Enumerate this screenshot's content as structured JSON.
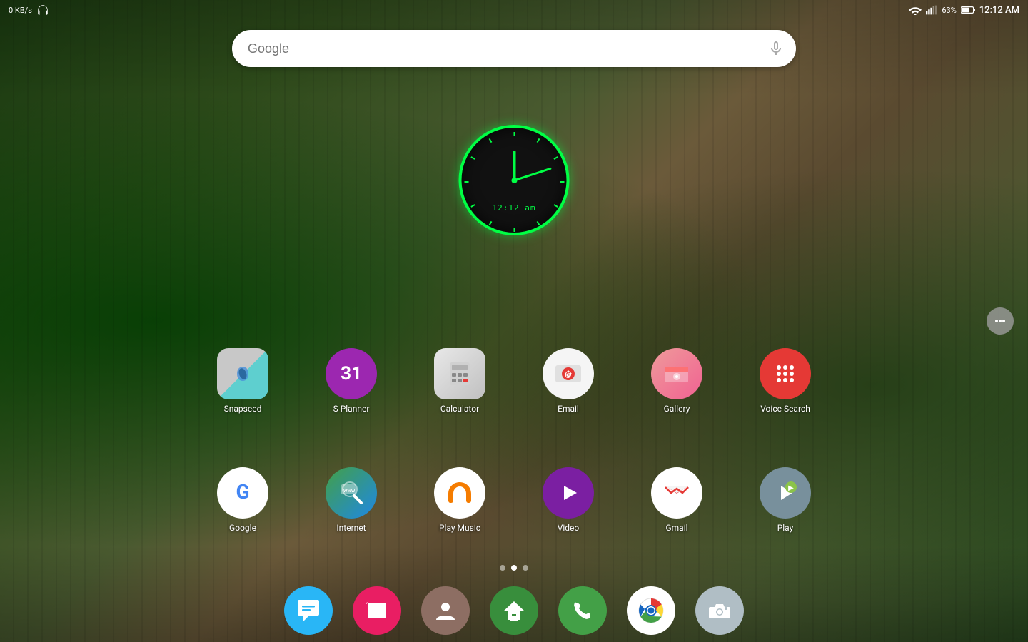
{
  "statusBar": {
    "leftIcons": "0 KB/s",
    "headphonesIcon": "headphones",
    "wifiIcon": "wifi",
    "signalIcon": "signal",
    "batteryPercent": "63%",
    "batteryIcon": "battery",
    "time": "12:12 AM"
  },
  "searchBar": {
    "placeholder": "Google",
    "micIcon": "microphone"
  },
  "clock": {
    "digital": "12:12 am"
  },
  "pageDots": [
    {
      "active": false
    },
    {
      "active": false
    },
    {
      "active": true
    }
  ],
  "appsRow1": [
    {
      "name": "snapseed",
      "label": "Snapseed"
    },
    {
      "name": "splanner",
      "label": "S Planner"
    },
    {
      "name": "calculator",
      "label": "Calculator"
    },
    {
      "name": "email",
      "label": "Email"
    },
    {
      "name": "gallery",
      "label": "Gallery"
    },
    {
      "name": "voicesearch",
      "label": "Voice Search"
    }
  ],
  "appsRow2": [
    {
      "name": "google",
      "label": "Google"
    },
    {
      "name": "internet",
      "label": "Internet"
    },
    {
      "name": "playmusic",
      "label": "Play Music"
    },
    {
      "name": "video",
      "label": "Video"
    },
    {
      "name": "gmail",
      "label": "Gmail"
    },
    {
      "name": "play",
      "label": "Play"
    }
  ],
  "dock": [
    {
      "name": "messages",
      "label": ""
    },
    {
      "name": "galaxy",
      "label": ""
    },
    {
      "name": "contacts",
      "label": ""
    },
    {
      "name": "home",
      "label": ""
    },
    {
      "name": "phone",
      "label": ""
    },
    {
      "name": "chrome",
      "label": ""
    },
    {
      "name": "camera",
      "label": ""
    }
  ]
}
